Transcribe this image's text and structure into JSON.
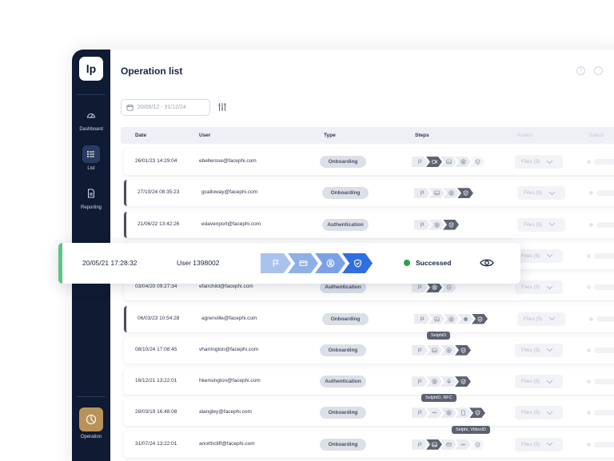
{
  "app": {
    "logo_text": "lp"
  },
  "sidebar": {
    "items": [
      {
        "label": "Dashboard",
        "icon": "gauge-icon"
      },
      {
        "label": "List",
        "icon": "list-icon"
      },
      {
        "label": "Reporting",
        "icon": "document-icon"
      },
      {
        "label": "Operation",
        "icon": "pie-chart-icon"
      }
    ]
  },
  "header": {
    "title": "Operation list"
  },
  "filters": {
    "date_range": "20/05/12 - 31/12/24"
  },
  "table": {
    "columns": [
      "Date",
      "User",
      "Type",
      "Steps",
      "Assets",
      "Status"
    ],
    "rows": [
      {
        "date": "26/01/23 14:29:04",
        "user": "ebellerose@facephi.com",
        "type": "Onboarding",
        "assets": "Files (5)"
      },
      {
        "date": "27/10/24 08:35:23",
        "user": "gcalloway@facephi.com",
        "type": "Onboarding",
        "assets": "Files (5)"
      },
      {
        "date": "21/06/22 13:42:26",
        "user": "edavenport@facephi.com",
        "type": "Authentication",
        "assets": "Files (5)"
      },
      {
        "date": "",
        "user": "",
        "type": "",
        "assets": "Files (5)"
      },
      {
        "date": "03/04/20 09:27:34",
        "user": "efairchild@facephi.com",
        "type": "Authentication",
        "assets": "Files (5)"
      },
      {
        "date": "06/03/23 10:54:28",
        "user": "agrenville@facephi.com",
        "type": "Onboarding",
        "assets": "Files (5)"
      },
      {
        "date": "08/10/24 17:08:45",
        "user": "vharrington@facephi.com",
        "type": "Onboarding",
        "assets": "Files (5)"
      },
      {
        "date": "16/12/21 13:22:01",
        "user": "hkensington@facephi.com",
        "type": "Authentication",
        "assets": "Files (5)"
      },
      {
        "date": "28/03/19 16:48:08",
        "user": "alangley@facephi.com",
        "type": "Onboarding",
        "assets": "Files (5)"
      },
      {
        "date": "31/07/24 13:22:01",
        "user": "anorthcliff@facephi.com",
        "type": "Onboarding",
        "assets": "Files (5)"
      }
    ]
  },
  "tooltips": [
    "SelphiD",
    "SelphiD, NFC",
    "Selphi, VideoID"
  ],
  "highlight": {
    "date": "20/05/21 17:28:32",
    "user": "User 1398002",
    "status": "Successed",
    "status_color": "#27a24d",
    "step_colors": [
      "#a9c3ee",
      "#8eb0e8",
      "#7ba1e6",
      "#2f6ee0"
    ]
  },
  "colors": {
    "sidebar": "#0f1a33",
    "accent": "#2f6ee0",
    "success": "#5fc481"
  }
}
